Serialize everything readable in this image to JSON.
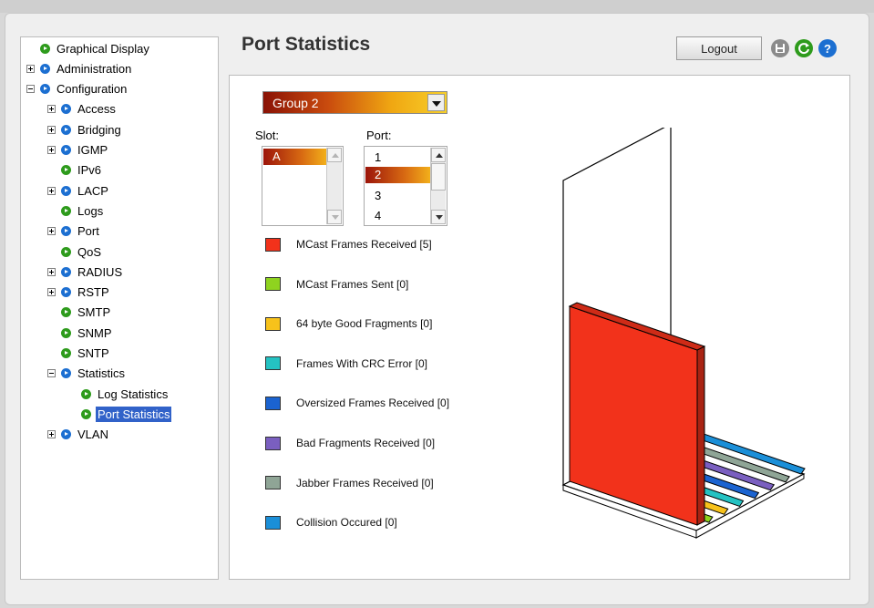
{
  "nav": {
    "items": [
      {
        "label": "Graphical Display",
        "level": 0,
        "expander": "none",
        "icon": "green",
        "selected": false
      },
      {
        "label": "Administration",
        "level": 0,
        "expander": "plus",
        "icon": "blue",
        "selected": false
      },
      {
        "label": "Configuration",
        "level": 0,
        "expander": "minus",
        "icon": "blue",
        "selected": false
      },
      {
        "label": "Access",
        "level": 1,
        "expander": "plus",
        "icon": "blue",
        "selected": false
      },
      {
        "label": "Bridging",
        "level": 1,
        "expander": "plus",
        "icon": "blue",
        "selected": false
      },
      {
        "label": "IGMP",
        "level": 1,
        "expander": "plus",
        "icon": "blue",
        "selected": false
      },
      {
        "label": "IPv6",
        "level": 1,
        "expander": "none",
        "icon": "green",
        "selected": false
      },
      {
        "label": "LACP",
        "level": 1,
        "expander": "plus",
        "icon": "blue",
        "selected": false
      },
      {
        "label": "Logs",
        "level": 1,
        "expander": "none",
        "icon": "green",
        "selected": false
      },
      {
        "label": "Port",
        "level": 1,
        "expander": "plus",
        "icon": "blue",
        "selected": false
      },
      {
        "label": "QoS",
        "level": 1,
        "expander": "none",
        "icon": "green",
        "selected": false
      },
      {
        "label": "RADIUS",
        "level": 1,
        "expander": "plus",
        "icon": "blue",
        "selected": false
      },
      {
        "label": "RSTP",
        "level": 1,
        "expander": "plus",
        "icon": "blue",
        "selected": false
      },
      {
        "label": "SMTP",
        "level": 1,
        "expander": "none",
        "icon": "green",
        "selected": false
      },
      {
        "label": "SNMP",
        "level": 1,
        "expander": "none",
        "icon": "green",
        "selected": false
      },
      {
        "label": "SNTP",
        "level": 1,
        "expander": "none",
        "icon": "green",
        "selected": false
      },
      {
        "label": "Statistics",
        "level": 1,
        "expander": "minus",
        "icon": "blue",
        "selected": false
      },
      {
        "label": "Log Statistics",
        "level": 2,
        "expander": "none",
        "icon": "green",
        "selected": false
      },
      {
        "label": "Port Statistics",
        "level": 2,
        "expander": "none",
        "icon": "green",
        "selected": true
      },
      {
        "label": "VLAN",
        "level": 1,
        "expander": "plus",
        "icon": "blue",
        "selected": false
      }
    ]
  },
  "header": {
    "title": "Port Statistics",
    "logout_label": "Logout",
    "icons": [
      "save-icon",
      "refresh-icon",
      "help-icon"
    ]
  },
  "group_select": {
    "value": "Group 2"
  },
  "slot": {
    "label": "Slot:",
    "options": [
      "A"
    ],
    "selected": "A"
  },
  "port": {
    "label": "Port:",
    "options": [
      "1",
      "2",
      "3",
      "4"
    ],
    "selected": "2"
  },
  "legend": [
    {
      "label": "MCast Frames Received [5]",
      "color": "#f2321b"
    },
    {
      "label": "MCast Frames Sent [0]",
      "color": "#8fd31f"
    },
    {
      "label": "64 byte Good Fragments [0]",
      "color": "#f7c21b"
    },
    {
      "label": "Frames With CRC Error [0]",
      "color": "#24c2c2"
    },
    {
      "label": "Oversized Frames Received [0]",
      "color": "#1b63d0"
    },
    {
      "label": "Bad Fragments Received [0]",
      "color": "#7a5fc0"
    },
    {
      "label": "Jabber Frames Received [0]",
      "color": "#8fa596"
    },
    {
      "label": "Collision Occured [0]",
      "color": "#1b8fd8"
    }
  ],
  "chart_data": {
    "type": "bar",
    "categories": [
      "MCast Frames Received",
      "MCast Frames Sent",
      "64 byte Good Fragments",
      "Frames With CRC Error",
      "Oversized Frames Received",
      "Bad Fragments Received",
      "Jabber Frames Received",
      "Collision Occured"
    ],
    "values": [
      5,
      0,
      0,
      0,
      0,
      0,
      0,
      0
    ],
    "colors": [
      "#f2321b",
      "#8fd31f",
      "#f7c21b",
      "#24c2c2",
      "#1b63d0",
      "#7a5fc0",
      "#8fa596",
      "#1b8fd8"
    ],
    "style": "3d"
  }
}
